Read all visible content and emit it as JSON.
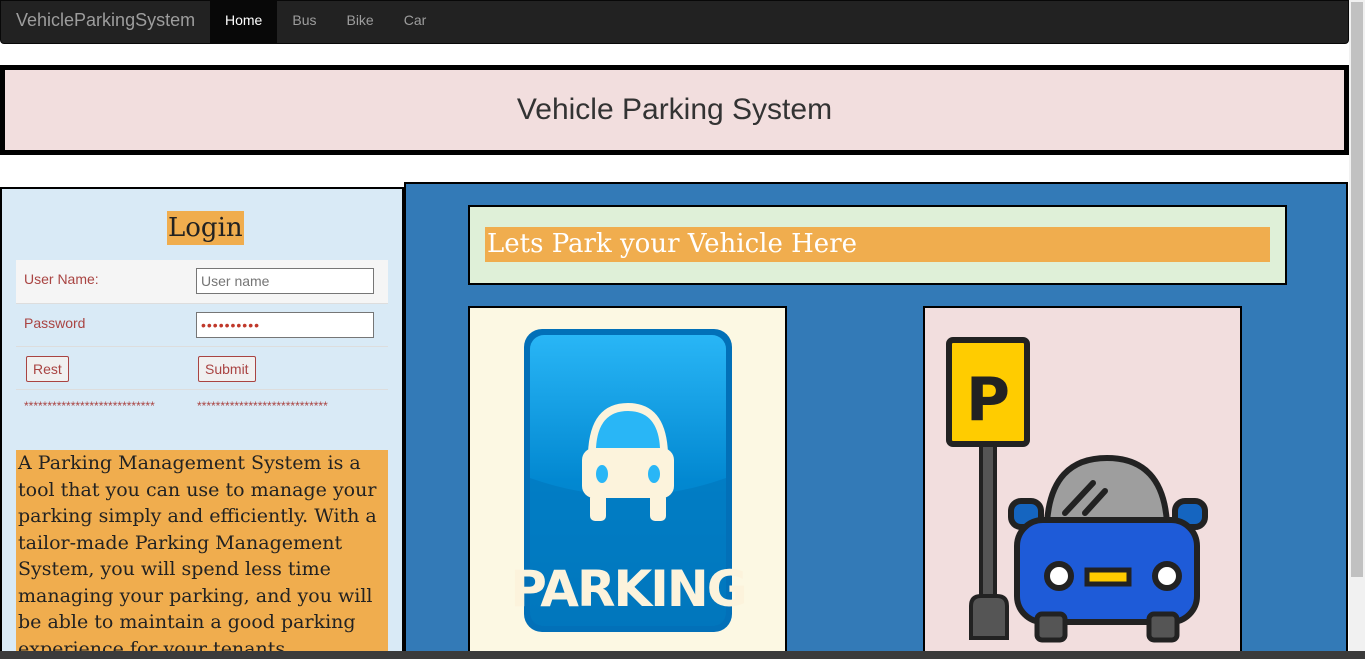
{
  "navbar": {
    "brand": "VehicleParkingSystem",
    "items": [
      {
        "label": "Home",
        "active": true
      },
      {
        "label": "Bus",
        "active": false
      },
      {
        "label": "Bike",
        "active": false
      },
      {
        "label": "Car",
        "active": false
      }
    ]
  },
  "header": {
    "title": "Vehicle Parking System"
  },
  "login": {
    "title": "Login",
    "username_label": "User Name:",
    "username_placeholder": "User name",
    "password_label": "Password",
    "password_value": "••••••••••",
    "reset_label": "Rest",
    "submit_label": "Submit",
    "validation_left": "****************************",
    "validation_right": "****************************"
  },
  "description": "A Parking Management System is a tool that you can use to manage your parking simply and efficiently. With a tailor-made Parking Management System, you will spend less time managing your parking, and you will be able to maintain a good parking experience for your tenants.",
  "main": {
    "tagline": "Lets Park your Vehicle Here",
    "sign_text": "PARKING",
    "post_letter": "P"
  },
  "colors": {
    "navbar_bg": "#222222",
    "header_bg": "#f2dede",
    "login_bg": "#d9eaf6",
    "accent_orange": "#f0ad4e",
    "main_bg": "#337ab7",
    "tagline_box_bg": "#dff0d8",
    "error_text": "#a94442"
  },
  "icons": [
    "parking-sign-icon",
    "parking-car-icon"
  ]
}
